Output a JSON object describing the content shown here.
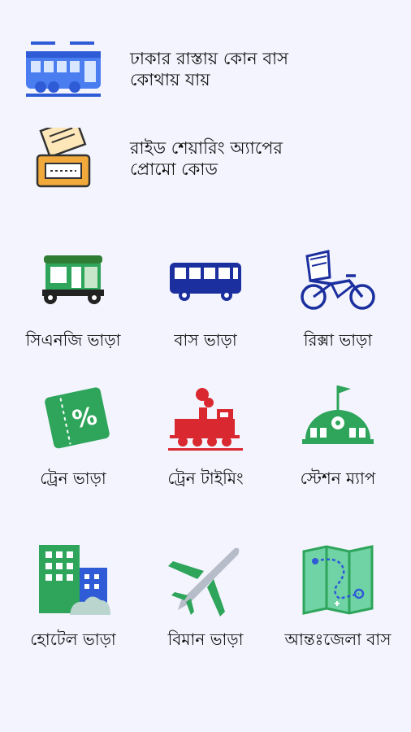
{
  "top_items": [
    {
      "label": "ঢাকার রাস্তায় কোন বাস\nকোথায় যায়",
      "icon": "bus-route-icon"
    },
    {
      "label": "রাইড শেয়ারিং অ্যাপের\nপ্রোমো কোড",
      "icon": "promo-ticket-icon"
    }
  ],
  "grid": [
    {
      "label": "সিএনজি ভাড়া",
      "icon": "cng-icon"
    },
    {
      "label": "বাস ভাড়া",
      "icon": "bus-icon"
    },
    {
      "label": "রিক্সা ভাড়া",
      "icon": "rickshaw-icon"
    },
    {
      "label": "ট্রেন ভাড়া",
      "icon": "train-ticket-icon"
    },
    {
      "label": "ট্রেন টাইমিং",
      "icon": "train-icon"
    },
    {
      "label": "স্টেশন ম্যাপ",
      "icon": "station-icon"
    },
    {
      "label": "হোটেল ভাড়া",
      "icon": "hotel-icon"
    },
    {
      "label": "বিমান ভাড়া",
      "icon": "airplane-icon"
    },
    {
      "label": "আন্তঃজেলা বাস",
      "icon": "map-icon"
    }
  ],
  "colors": {
    "blue": "#2f5bd6",
    "navy": "#1b2f9e",
    "green": "#2ea55a",
    "red": "#d9282f",
    "orange": "#f2a93b",
    "background": "#f3f4fd"
  }
}
